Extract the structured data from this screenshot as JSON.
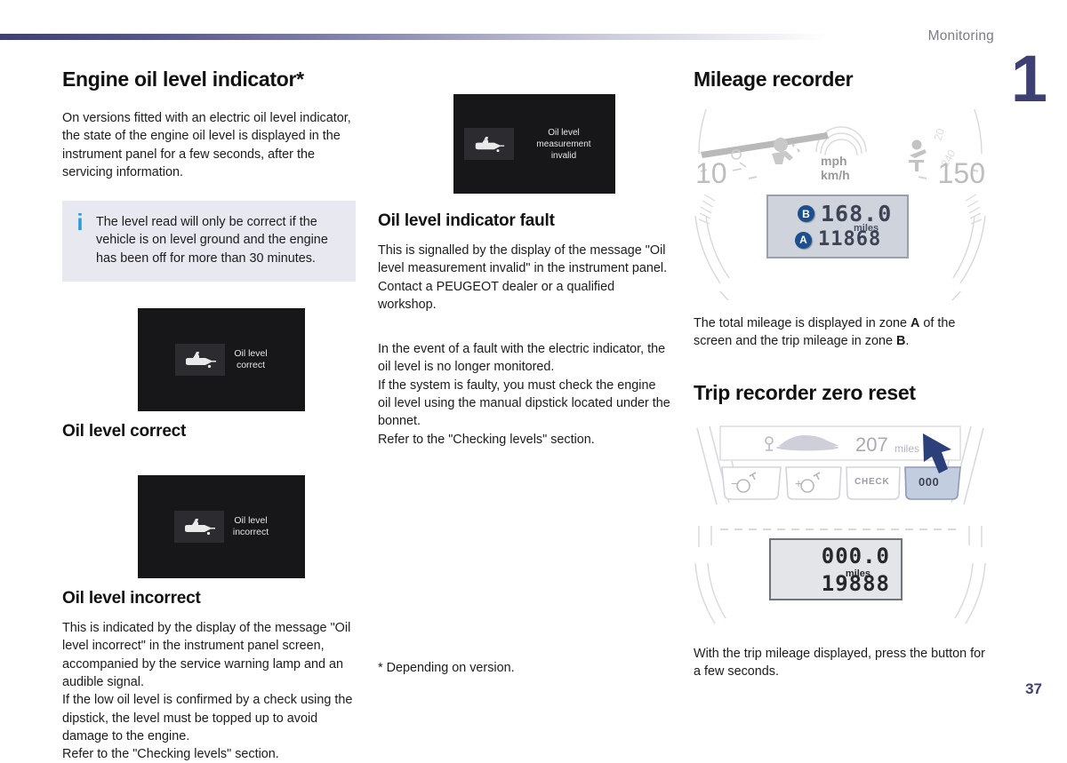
{
  "header": {
    "section_label": "Monitoring",
    "chapter_number": "1",
    "accent_color": "#3e3f72"
  },
  "left_column": {
    "title": "Engine oil level indicator*",
    "intro": "On versions fitted with an electric oil level indicator, the state of the engine oil level is displayed in the instrument panel for a few seconds, after the servicing information.",
    "info_box": {
      "icon": "info-i-icon",
      "text": "The level read will only be correct if the vehicle is on level ground and the engine has been off for more than 30 minutes.",
      "background_color": "#e8e8f0",
      "icon_color": "#2f9bd6"
    },
    "display_correct": {
      "icon": "oil-can-icon",
      "line1": "Oil level",
      "line2": "correct"
    },
    "caption_correct": "Oil level correct",
    "display_incorrect": {
      "icon": "oil-can-icon",
      "line1": "Oil level",
      "line2": "incorrect"
    },
    "caption_incorrect": "Oil level incorrect",
    "body_incorrect": "This is indicated by the display of the message \"Oil level incorrect\" in the instrument panel screen, accompanied by the service warning lamp and an audible signal.\nIf the low oil level is confirmed by a check using the dipstick, the level must be topped up to avoid damage to the engine.\nRefer to the \"Checking levels\" section."
  },
  "middle_column": {
    "display_invalid": {
      "icon": "oil-can-icon",
      "line1": "Oil level",
      "line2": "measurement invalid"
    },
    "title": "Oil level indicator fault",
    "paragraph1": "This is signalled by the display of the message \"Oil level measurement invalid\" in the instrument panel. Contact a PEUGEOT dealer or a qualified workshop.",
    "paragraph2": "In the event of a fault with the electric indicator, the oil level is no longer monitored.\nIf the system is faulty, you must check the engine oil level using the manual dipstick located under the bonnet.\nRefer to the \"Checking levels\" section."
  },
  "right_column": {
    "mileage_title": "Mileage recorder",
    "cluster": {
      "speed_low": "10",
      "speed_high": "150",
      "units_line1": "mph",
      "units_line2": "km/h",
      "lcd": {
        "zone_b_label": "B",
        "zone_b_value": "168.0",
        "units": "miles",
        "zone_a_label": "A",
        "zone_a_value": "11868"
      }
    },
    "mileage_caption_part1": "The total mileage is displayed in zone ",
    "mileage_caption_zone_a": "A",
    "mileage_caption_part2": " of the screen and the trip mileage in zone ",
    "mileage_caption_zone_b": "B",
    "mileage_caption_part3": ".",
    "trip_title": "Trip recorder zero reset",
    "trip_graphic": {
      "odometer_value": "207",
      "odometer_units": "miles",
      "buttons": [
        {
          "label": "−",
          "icon": "lamp-decrease-icon",
          "name": "brightness-decrease-button"
        },
        {
          "label": "+",
          "icon": "lamp-increase-icon",
          "name": "brightness-increase-button"
        },
        {
          "label": "CHECK",
          "icon": "",
          "name": "check-button"
        },
        {
          "label": "000",
          "icon": "",
          "name": "trip-reset-button"
        }
      ],
      "highlighted_button": "000",
      "arrow_color": "#2b3f7a"
    },
    "trip_lcd": {
      "top_value": "000.0",
      "units": "miles",
      "bottom_value": "19888"
    },
    "trip_caption": "With the trip mileage displayed, press the button for a few seconds."
  },
  "footer": {
    "footnote": "* Depending on version.",
    "page_number": "37"
  }
}
